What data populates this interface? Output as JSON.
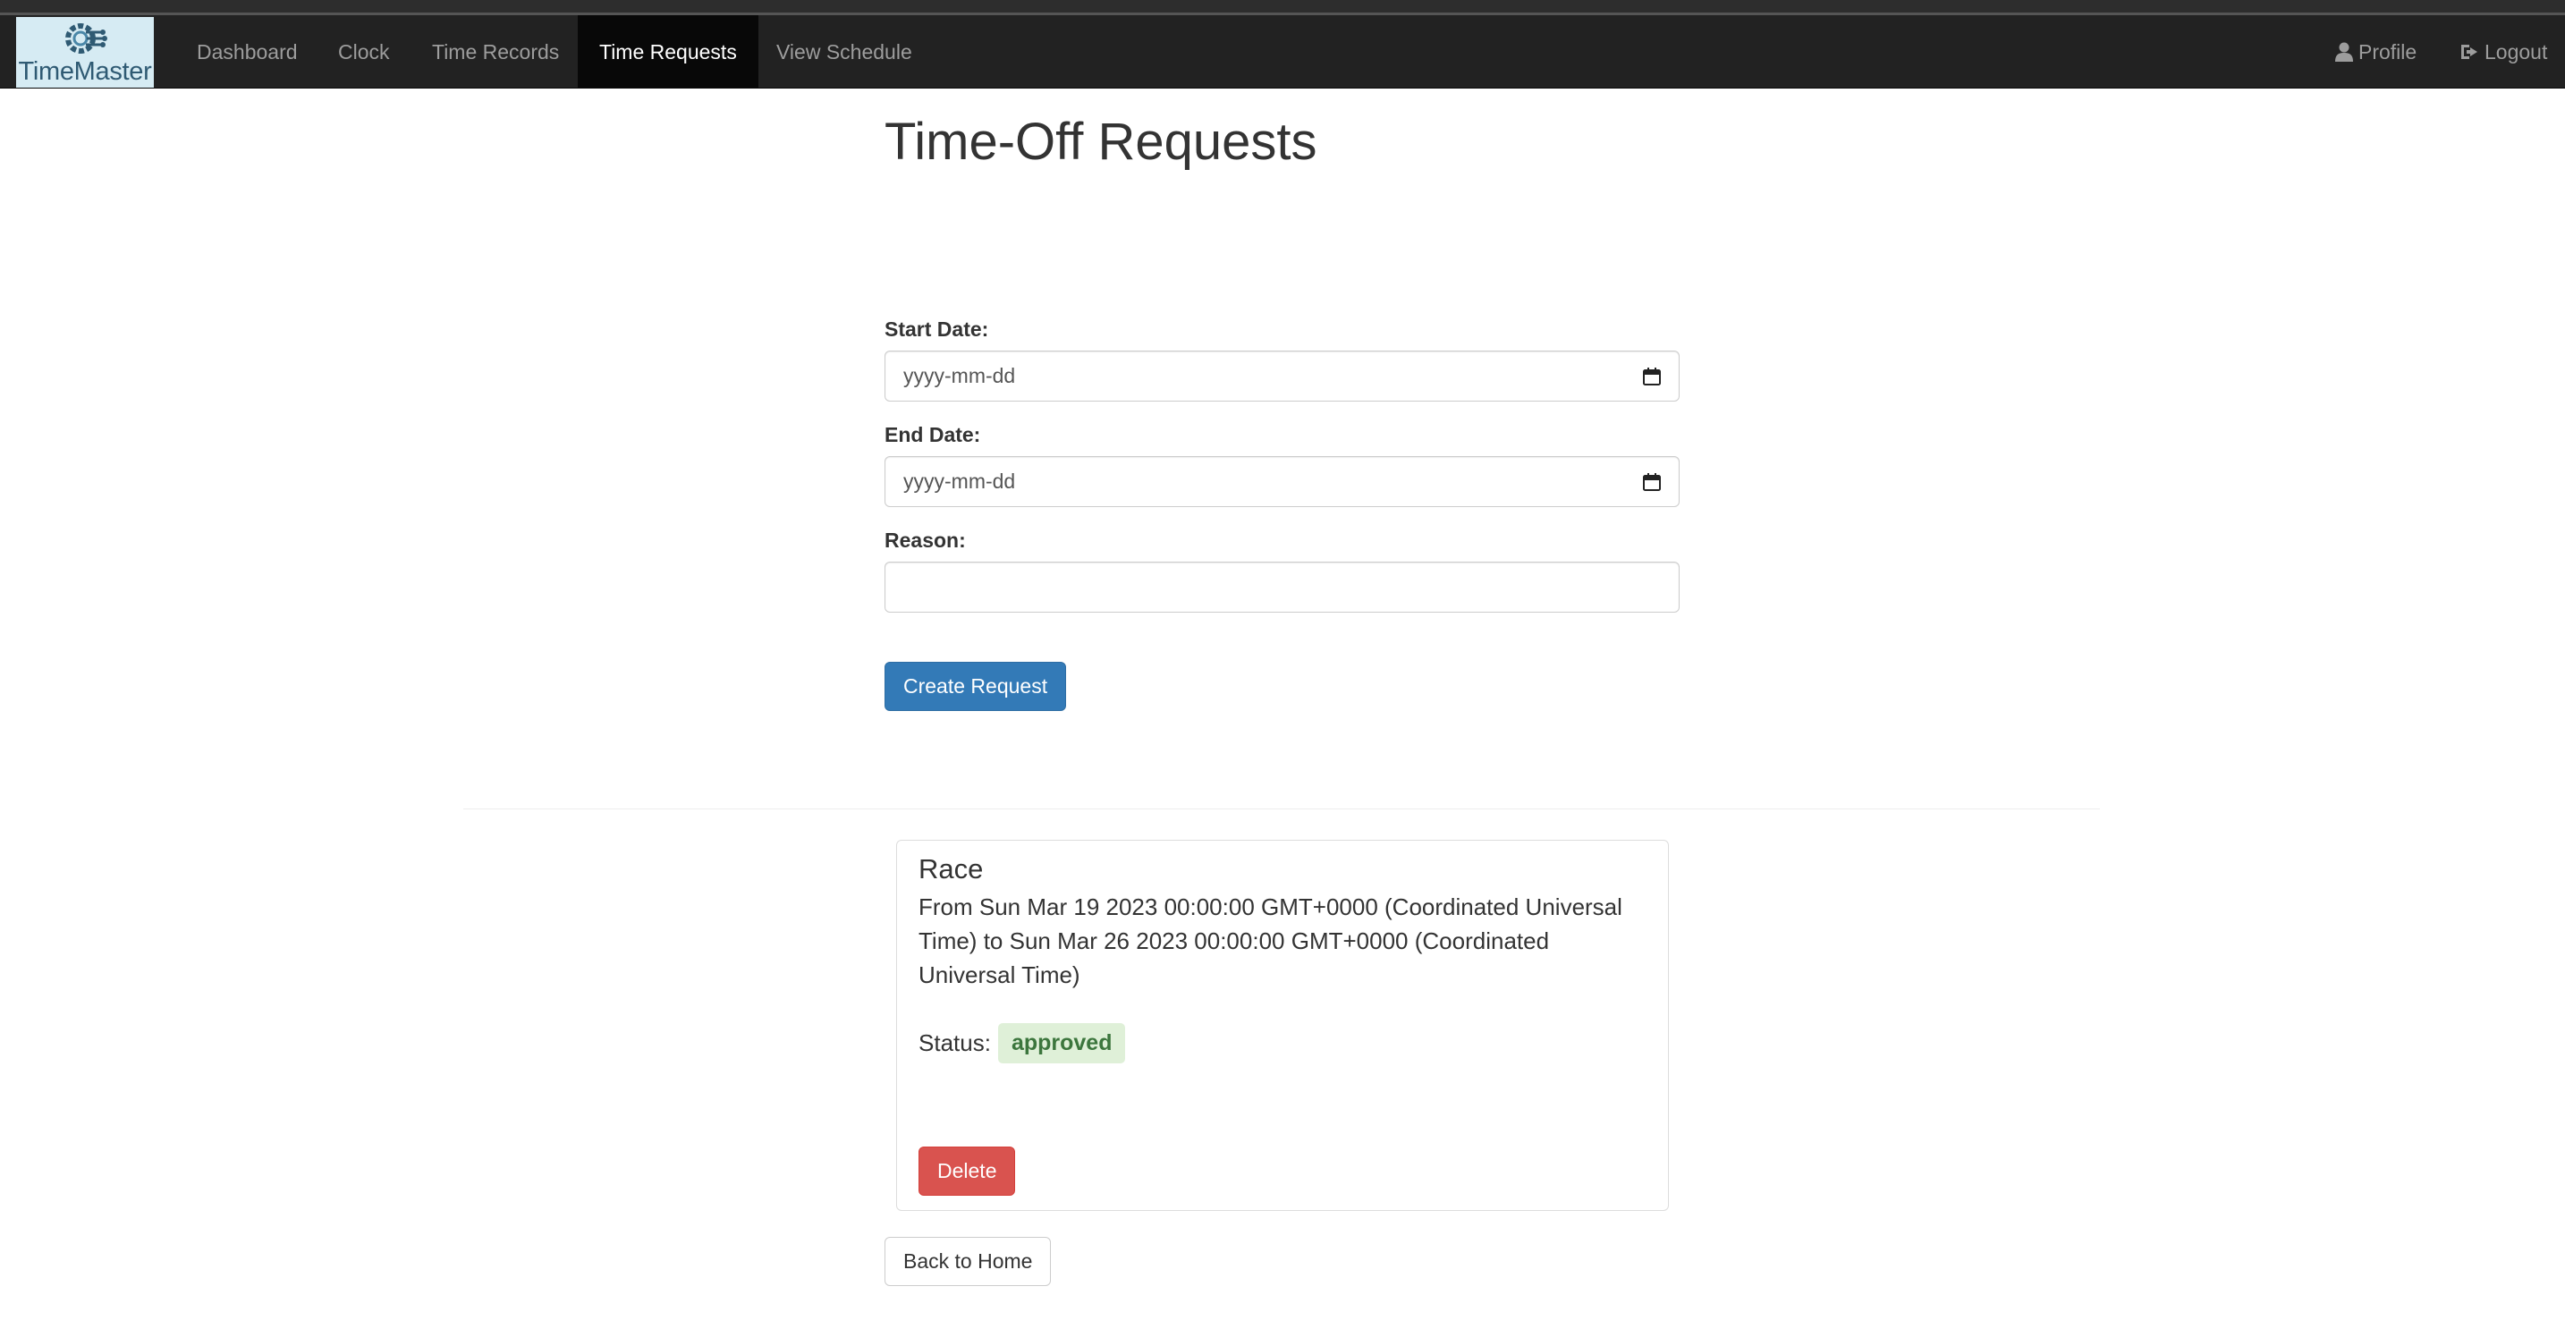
{
  "brand": {
    "name": "TimeMaster",
    "icon": "gear-circuit-logo",
    "color": "#2f5a73"
  },
  "nav": {
    "items": [
      {
        "label": "Dashboard"
      },
      {
        "label": "Clock"
      },
      {
        "label": "Time Records"
      },
      {
        "label": "Time Requests",
        "active": true
      },
      {
        "label": "View Schedule"
      }
    ],
    "profile": {
      "label": "Profile",
      "icon": "user-icon"
    },
    "logout": {
      "label": "Logout",
      "icon": "logout-icon"
    }
  },
  "page": {
    "title": "Time-Off Requests"
  },
  "form": {
    "start_date": {
      "label": "Start Date:",
      "placeholder": "yyyy-mm-dd",
      "value": ""
    },
    "end_date": {
      "label": "End Date:",
      "placeholder": "yyyy-mm-dd",
      "value": ""
    },
    "reason": {
      "label": "Reason:",
      "value": ""
    },
    "submit_label": "Create Request"
  },
  "requests": [
    {
      "reason": "Race",
      "dates": "From Sun Mar 19 2023 00:00:00 GMT+0000 (Coordinated Universal Time) to Sun Mar 26 2023 00:00:00 GMT+0000 (Coordinated Universal Time)",
      "status_label": "Status:",
      "status": "approved",
      "delete_label": "Delete"
    }
  ],
  "back_label": "Back to Home",
  "colors": {
    "primary": "#337ab7",
    "danger": "#d9534f",
    "success_bg": "#dff0d8",
    "success_text": "#3c763d",
    "navbar": "#222222"
  }
}
